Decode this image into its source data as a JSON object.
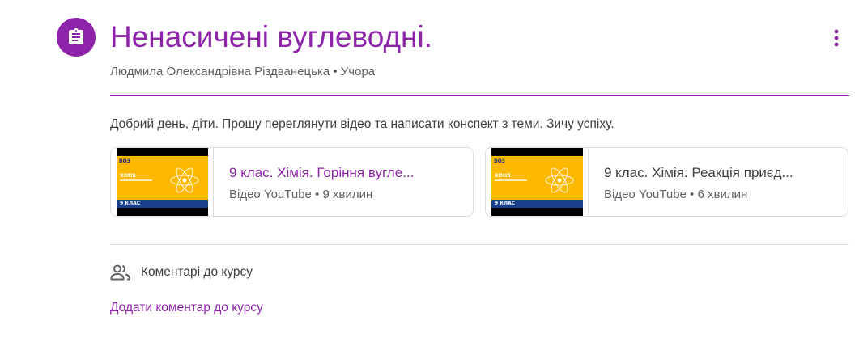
{
  "assignment": {
    "title": "Ненасичені вуглеводні.",
    "author": "Людмила Олександрівна Різдванецька",
    "meta_separator": " • ",
    "posted": "Учора",
    "description": "Добрий день, діти. Прошу переглянути відео та написати конспект з теми. Зичу успіху.",
    "accent_color": "#8e24aa",
    "icon": "assignment-icon",
    "menu_icon": "more-vert-icon"
  },
  "attachments": [
    {
      "title": "9 клас. Хімія. Горіння вугле...",
      "source": "Відео YouTube",
      "duration": "9 хвилин",
      "thumb": {
        "logo": "ВОЗ",
        "subject": "ХІМІЯ",
        "grade": "9 КЛАС"
      }
    },
    {
      "title": "9 клас. Хімія. Реакція приєд...",
      "source": "Відео YouTube",
      "duration": "6 хвилин",
      "thumb": {
        "logo": "ВОЗ",
        "subject": "ХІМІЯ",
        "grade": "9 КЛАС"
      }
    }
  ],
  "comments": {
    "label": "Коментарі до курсу",
    "icon": "people-icon",
    "add_label": "Додати коментар до курсу"
  }
}
